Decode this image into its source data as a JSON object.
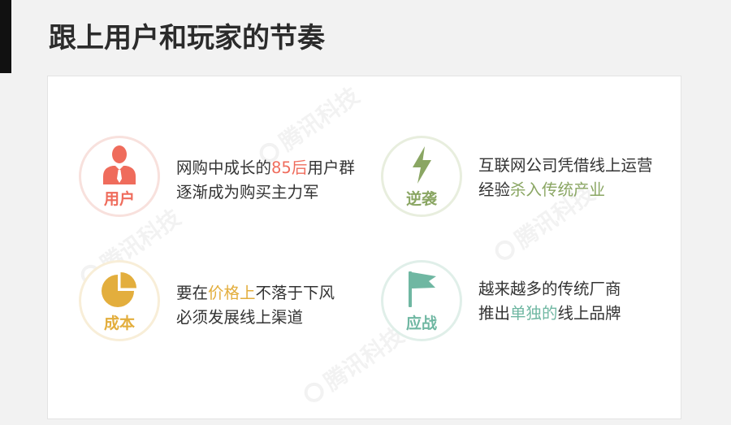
{
  "slide": {
    "title": "跟上用户和玩家的节奏",
    "watermark": "腾讯科技"
  },
  "items": [
    {
      "label": "用户",
      "icon": "person-icon",
      "accent": "#ef6c5c",
      "ring": "#f8e1dd",
      "lines": [
        [
          "网购中成长的",
          "85后",
          "用户群"
        ],
        [
          "逐渐成为购买主力军"
        ]
      ]
    },
    {
      "label": "逆袭",
      "icon": "lightning-icon",
      "accent": "#8aa663",
      "ring": "#e8eede",
      "lines": [
        [
          "互联网公司凭借线上运营"
        ],
        [
          "经验",
          "杀入传统产业"
        ]
      ]
    },
    {
      "label": "成本",
      "icon": "pie-chart-icon",
      "accent": "#e3ae3d",
      "ring": "#f8eed8",
      "lines": [
        [
          "要在",
          "价格上",
          "不落于下风"
        ],
        [
          "必须发展线上渠道"
        ]
      ]
    },
    {
      "label": "应战",
      "icon": "flag-icon",
      "accent": "#6fb7a2",
      "ring": "#e0efe9",
      "lines": [
        [
          "越来越多的传统厂商"
        ],
        [
          "推出",
          "单独的",
          "线上品牌"
        ]
      ]
    }
  ]
}
